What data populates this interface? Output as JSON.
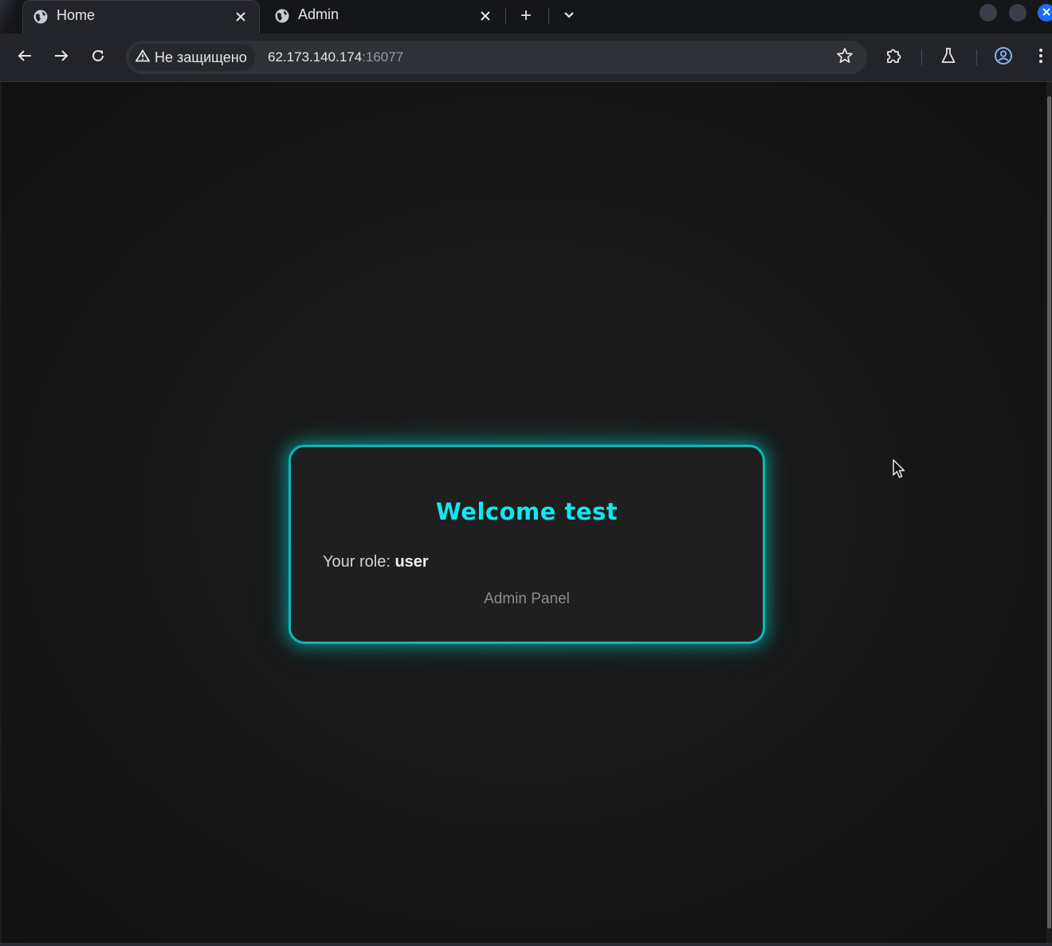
{
  "browser": {
    "tabs": [
      {
        "title": "Home",
        "active": true
      },
      {
        "title": "Admin",
        "active": false
      }
    ],
    "new_tab_label": "+",
    "address": {
      "security_label": "Не защищено",
      "host": "62.173.140.174",
      "port": ":16077"
    }
  },
  "page": {
    "card": {
      "title": "Welcome test",
      "role_label": "Your role:",
      "role_value": "user",
      "admin_link": "Admin Panel"
    }
  },
  "colors": {
    "accent": "#14e6f0",
    "card_border": "#0bb8b8",
    "page_bg": "#161616",
    "chrome_bg": "#232429",
    "window_close": "#1a6dff"
  }
}
